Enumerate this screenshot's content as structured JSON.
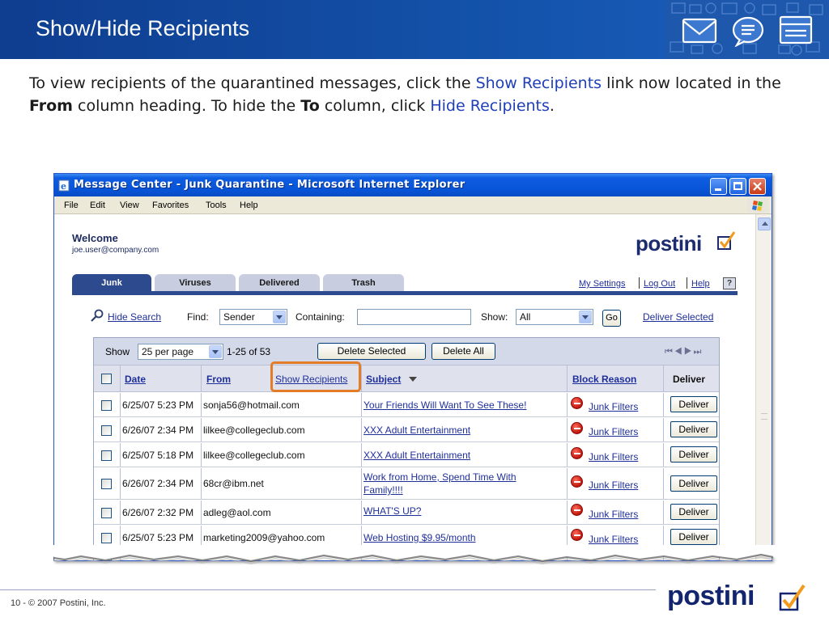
{
  "slide": {
    "title": "Show/Hide Recipients",
    "intro": {
      "p1": "To view recipients of the quarantined messages, click the ",
      "link1": "Show Recipients",
      "p2": " link now located in the ",
      "bold1": "From",
      "p3": " column heading. To hide the ",
      "bold2": "To",
      "p4": " column, click ",
      "link2": "Hide Recipients",
      "p5": "."
    },
    "footer": {
      "page_text": "10 - © 2007 Postini, Inc.",
      "logo_text": "postini"
    },
    "colors": {
      "header_blue": "#1351a8",
      "highlight_orange": "#e47b26",
      "link_blue": "#1f2f9a"
    }
  },
  "browser": {
    "title": "Message Center - Junk Quarantine - Microsoft Internet Explorer",
    "menu": [
      "File",
      "Edit",
      "View",
      "Favorites",
      "Tools",
      "Help"
    ],
    "icons": {
      "app": "ie-icon",
      "minimize": "minimize-icon",
      "maximize": "maximize-icon",
      "close": "close-icon",
      "throbber": "windows-logo-icon"
    }
  },
  "app": {
    "welcome": "Welcome",
    "email": "joe.user@company.com",
    "logo_text": "postini",
    "tabs": [
      "Junk",
      "Viruses",
      "Delivered",
      "Trash"
    ],
    "active_tab": "Junk",
    "top_links": {
      "settings": "My Settings",
      "logout": "Log Out",
      "help": "Help",
      "help_icon": "?"
    },
    "search": {
      "hide_search": "Hide Search",
      "find_label": "Find:",
      "find_value": "Sender",
      "containing_label": "Containing:",
      "containing_value": "",
      "show_label": "Show:",
      "show_value": "All",
      "go_label": "Go",
      "deliver_selected": "Deliver Selected"
    },
    "grid": {
      "show_label": "Show",
      "per_page": "25 per page",
      "range": "1-25 of 53",
      "delete_selected": "Delete Selected",
      "delete_all": "Delete All",
      "pager": "⏮◀▶⏭",
      "columns": {
        "date": "Date",
        "from": "From",
        "show_recipients": "Show Recipients",
        "subject": "Subject",
        "block_reason": "Block Reason",
        "deliver": "Deliver"
      },
      "rows": [
        {
          "date": "6/25/07 5:23 PM",
          "from": "sonja56@hotmail.com",
          "subject": "Your Friends Will Want To See These!",
          "subject2": "",
          "reason": "Junk Filters",
          "action": "Deliver"
        },
        {
          "date": "6/26/07 2:34 PM",
          "from": "lilkee@collegeclub.com",
          "subject": "XXX Adult Entertainment",
          "subject2": "",
          "reason": "Junk Filters",
          "action": "Deliver"
        },
        {
          "date": "6/25/07 5:18 PM",
          "from": "lilkee@collegeclub.com",
          "subject": "XXX Adult Entertainment",
          "subject2": "",
          "reason": "Junk Filters",
          "action": "Deliver"
        },
        {
          "date": "6/26/07 2:34 PM",
          "from": "68cr@ibm.net",
          "subject": "Work from Home, Spend Time With",
          "subject2": "Family!!!!",
          "reason": "Junk Filters",
          "action": "Deliver"
        },
        {
          "date": "6/26/07 2:32 PM",
          "from": "adleg@aol.com",
          "subject": "WHAT'S UP?",
          "subject2": "",
          "reason": "Junk Filters",
          "action": "Deliver"
        },
        {
          "date": "6/25/07 5:23 PM",
          "from": "marketing2009@yahoo.com",
          "subject": "Web Hosting $9.95/month",
          "subject2": "",
          "reason": "Junk Filters",
          "action": "Deliver"
        }
      ]
    }
  }
}
